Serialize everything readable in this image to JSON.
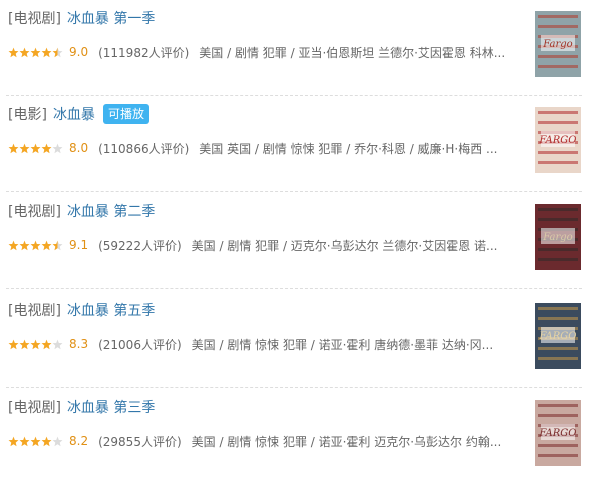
{
  "results": [
    {
      "type_tag": "[电视剧]",
      "title": "冰血暴 第一季",
      "badge": "",
      "stars": 4.5,
      "rating": "9.0",
      "votes": "(111982人评价)",
      "abstract": "美国 / 剧情 犯罪 / 亚当·伯恩斯坦 兰德尔·艾因霍恩 科林...",
      "poster": {
        "bg": "#8fa3a8",
        "band": "#b23a2a",
        "text": "Fargo",
        "text_color": "#a03528"
      }
    },
    {
      "type_tag": "[电影]",
      "title": "冰血暴",
      "badge": "可播放",
      "stars": 4,
      "rating": "8.0",
      "votes": "(110866人评价)",
      "abstract": "美国 英国 / 剧情 惊悚 犯罪 / 乔尔·科恩 / 威廉·H·梅西 ...",
      "poster": {
        "bg": "#e9d6c9",
        "band": "#b02a2a",
        "text": "FARGO",
        "text_color": "#b02a2a"
      }
    },
    {
      "type_tag": "[电视剧]",
      "title": "冰血暴 第二季",
      "badge": "",
      "stars": 4.5,
      "rating": "9.1",
      "votes": "(59222人评价)",
      "abstract": "美国 / 剧情 犯罪 / 迈克尔·乌彭达尔 兰德尔·艾因霍恩 诺...",
      "poster": {
        "bg": "#6b2a2e",
        "band": "#2d2a2a",
        "text": "Fargo",
        "text_color": "#d9c9a8"
      }
    },
    {
      "type_tag": "[电视剧]",
      "title": "冰血暴 第五季",
      "badge": "",
      "stars": 4,
      "rating": "8.3",
      "votes": "(21006人评价)",
      "abstract": "美国 / 剧情 惊悚 犯罪 / 诺亚·霍利 唐纳德·墨菲 达纳·冈...",
      "poster": {
        "bg": "#3b4b5e",
        "band": "#c99a4a",
        "text": "FARGO",
        "text_color": "#e6d3a3"
      }
    },
    {
      "type_tag": "[电视剧]",
      "title": "冰血暴 第三季",
      "badge": "",
      "stars": 4,
      "rating": "8.2",
      "votes": "(29855人评价)",
      "abstract": "美国 / 剧情 惊悚 犯罪 / 诺亚·霍利 迈克尔·乌彭达尔 约翰...",
      "poster": {
        "bg": "#c9a9a0",
        "band": "#7a2a2a",
        "text": "FARGO",
        "text_color": "#7a2a2a"
      }
    }
  ],
  "colors": {
    "star_full": "#f4a623",
    "star_empty": "#dcdcdc",
    "link": "#3377aa",
    "rating": "#e09015",
    "badge": "#3fb3f0"
  }
}
